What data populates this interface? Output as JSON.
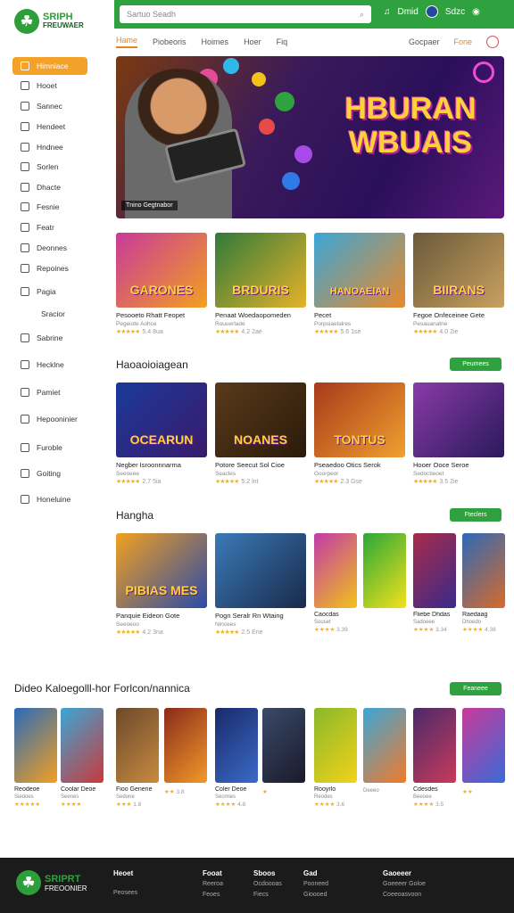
{
  "brand": {
    "line1": "SRIPH",
    "line2": "FREUWAER",
    "mark": "☘"
  },
  "search": {
    "placeholder": "Sartuo Seadh"
  },
  "top_actions": {
    "label": "Dmid",
    "label2": "Sdzc"
  },
  "nav": {
    "tabs": [
      "Hame",
      "Piobeoris",
      "Hoimes",
      "Hoer",
      "Fiq"
    ],
    "right": [
      "Gocpaer",
      "Fone"
    ]
  },
  "sidebar": {
    "items": [
      "Himniace",
      "Hooet",
      "Sannec",
      "Hendeet",
      "Hndnee",
      "Sorlen",
      "Dhacte",
      "Fesnie",
      "Featr",
      "Deonnes",
      "Repoines",
      "Pagia",
      "Sracior",
      "Sabrine",
      "Hecklne",
      "Pamiet",
      "Hepooninier",
      "Furoble",
      "Goiting",
      "Honeluine"
    ]
  },
  "hero": {
    "title_line1": "HBURAN",
    "title_line2": "WBUAIS",
    "caption": "Tnino Gegtnabor"
  },
  "row1": [
    {
      "title": "GARONES",
      "name": "Pesooeto Rhatt Feopet",
      "meta": "Pegeiote Aohce",
      "rating": "★★★★★",
      "count": "5.4 8ua",
      "c1": "#c93a9a",
      "c2": "#f2a020"
    },
    {
      "title": "BRDURIS",
      "name": "Penaat Woedaopomeden",
      "meta": "Rouuerlade",
      "rating": "★★★★★",
      "count": "4.2 2ae",
      "c1": "#2f7a3a",
      "c2": "#e6b22a"
    },
    {
      "title": "HANOAEIAN",
      "name": "Pecet",
      "meta": "Porpsiaelalres",
      "rating": "★★★★★",
      "count": "5.6 1se",
      "c1": "#3aa6d8",
      "c2": "#e88a2a"
    },
    {
      "title": "BIIRANS",
      "name": "Fegoe Onfeceinee Gete",
      "meta": "Pesauanatne",
      "rating": "★★★★★",
      "count": "4.0 2ie",
      "c1": "#6a5a3a",
      "c2": "#c9a060"
    }
  ],
  "section2": {
    "title": "Haoaoioiagean",
    "button": "Peumees"
  },
  "row2": [
    {
      "title": "OCEARUN",
      "name": "Negber Isroonnnarma",
      "meta": "Seeoeee",
      "rating": "★★★★★",
      "count": "2.7 5ia",
      "c1": "#1a3a9a",
      "c2": "#3a1a6a"
    },
    {
      "title": "NOANES",
      "name": "Potore Seecut Sol Cioe",
      "meta": "Seacles",
      "rating": "★★★★★",
      "count": "5.2 lnt",
      "c1": "#5a3a1a",
      "c2": "#2a1a0a"
    },
    {
      "title": "TONTUS",
      "name": "Pseaedoo Otics Serok",
      "meta": "Goorpeor",
      "rating": "★★★★★",
      "count": "2.3 Gse",
      "c1": "#a83a1a",
      "c2": "#f0a030"
    },
    {
      "title": "",
      "name": "Hooer Ooce Seroe",
      "meta": "Sedoctieoet",
      "rating": "★★★★★",
      "count": "3.5 2ie",
      "c1": "#8a3aa8",
      "c2": "#2a1a5a"
    }
  ],
  "section3": {
    "title": "Hangha",
    "button": "Fteclers"
  },
  "row3": [
    {
      "title": "PIBIAS MES",
      "name": "Panquie Eideon Gote",
      "meta": "Seeoeoo",
      "rating": "★★★★★",
      "count": "4.2 3na",
      "c1": "#f2a020",
      "c2": "#2a4aa8"
    },
    {
      "title": "",
      "name": "Pogn Seralr Rn Wtaing",
      "meta": "Nincees",
      "rating": "★★★★★",
      "count": "2.5 Ene",
      "c1": "#3a7ab8",
      "c2": "#1a2a4a"
    }
  ],
  "row3_halves": [
    {
      "name": "Caocdas",
      "meta": "Souset",
      "rating": "★★★★",
      "count": "3.39",
      "c1": "#c23aa8",
      "c2": "#f2c21a"
    },
    {
      "name": "",
      "meta": "",
      "rating": "",
      "count": "",
      "c1": "#2aa83a",
      "c2": "#f2e21a"
    },
    {
      "name": "Fliebe Dhdas",
      "meta": "Sadoeee",
      "rating": "★★★★",
      "count": "3.34",
      "c1": "#a82a4a",
      "c2": "#3a2a8a"
    },
    {
      "name": "Raedaag",
      "meta": "Dhoedo",
      "rating": "★★★★",
      "count": "4.38",
      "c1": "#2a6ab8",
      "c2": "#d86a2a"
    }
  ],
  "section4": {
    "title": "Dideo Kaloegolll-hor Forlcon/nannica",
    "button": "Feaneee"
  },
  "row4_halves": [
    {
      "name": "Reodeoe",
      "meta": "Siedoes",
      "rating": "★★★★★",
      "count": "",
      "c1": "#2a6ab8",
      "c2": "#f2a020"
    },
    {
      "name": "Coolar Deoe",
      "meta": "Seenes",
      "rating": "★★★★",
      "count": "",
      "c1": "#3aa6d8",
      "c2": "#c93a3a"
    },
    {
      "name": "Fioo Genene",
      "meta": "Sedone",
      "rating": "★★★",
      "count": "1.8",
      "c1": "#6a4a2a",
      "c2": "#c98a40"
    },
    {
      "name": "",
      "meta": "",
      "rating": "★★",
      "count": "3.8",
      "c1": "#8a2a1a",
      "c2": "#f29a2a"
    },
    {
      "name": "Coler Deoe",
      "meta": "Secmies",
      "rating": "★★★★",
      "count": "4.8",
      "c1": "#1a2a6a",
      "c2": "#3a6ac8"
    },
    {
      "name": "",
      "meta": "",
      "rating": "★",
      "count": "",
      "c1": "#3a4a6a",
      "c2": "#1a1a2a"
    },
    {
      "name": "Rooyrlo",
      "meta": "Reodes",
      "rating": "★★★★",
      "count": "3.6",
      "c1": "#8ab82a",
      "c2": "#f2d21a"
    },
    {
      "name": "",
      "meta": "Deeeo",
      "rating": "",
      "count": "",
      "c1": "#3aa6d8",
      "c2": "#f27a2a"
    },
    {
      "name": "Cdesdes",
      "meta": "Beeoee",
      "rating": "★★★★",
      "count": "3.5",
      "c1": "#4a2a6a",
      "c2": "#c83a5a"
    },
    {
      "name": "",
      "meta": "",
      "rating": "★★",
      "count": "",
      "c1": "#c93a9a",
      "c2": "#3a6ad8"
    }
  ],
  "footer": {
    "brand1": "SRIPRT",
    "brand2": "FREOONIER",
    "cols": [
      {
        "head": "Heoet",
        "items": [
          "Peosees"
        ]
      },
      {
        "head": "Fooat",
        "items": [
          "Reeroa",
          "Feoes"
        ]
      },
      {
        "head": "Sboos",
        "items": [
          "Ocdoooas",
          "Fiecs"
        ]
      },
      {
        "head": "Gad",
        "items": [
          "Pooneed",
          "Gioooed"
        ]
      },
      {
        "head": "Gaoeeer",
        "items": [
          "Goeeeer Goloe",
          "Coeeoasvoon"
        ]
      }
    ]
  },
  "colors": {
    "accent": "#2fa23f",
    "active": "#f4a12a",
    "link": "#e8851a",
    "footer_bg": "#1b1b1b"
  }
}
